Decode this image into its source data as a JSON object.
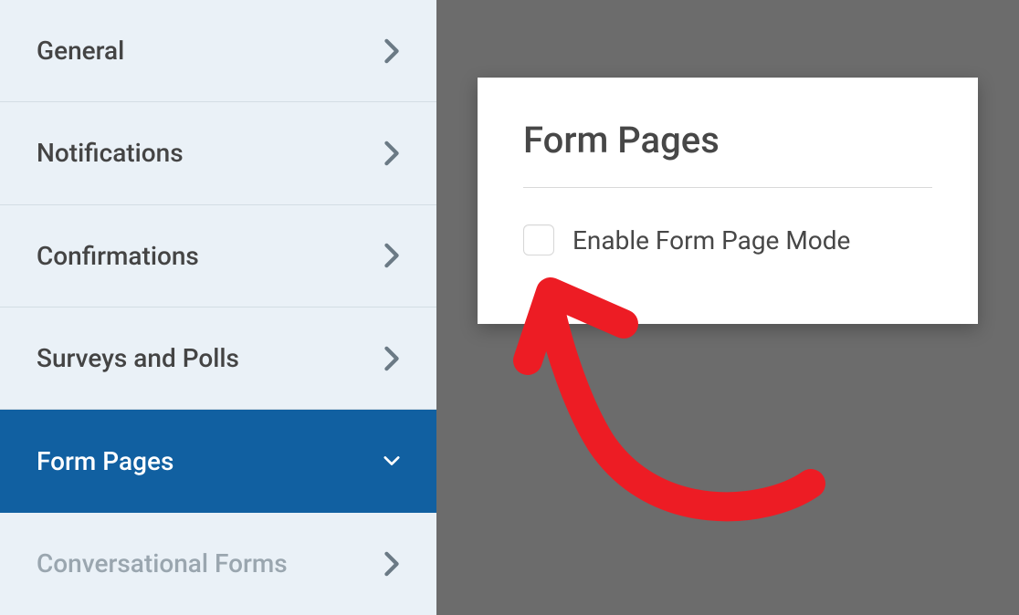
{
  "sidebar": {
    "items": [
      {
        "label": "General",
        "active": false
      },
      {
        "label": "Notifications",
        "active": false
      },
      {
        "label": "Confirmations",
        "active": false
      },
      {
        "label": "Surveys and Polls",
        "active": false
      },
      {
        "label": "Form Pages",
        "active": true
      },
      {
        "label": "Conversational Forms",
        "active": false
      }
    ]
  },
  "panel": {
    "title": "Form Pages",
    "checkbox_label": "Enable Form Page Mode"
  }
}
